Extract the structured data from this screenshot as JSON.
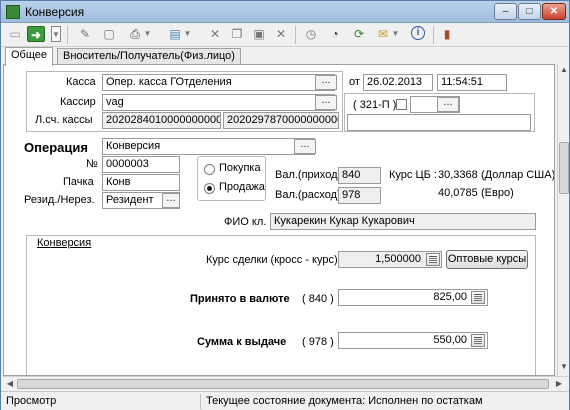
{
  "window": {
    "title": "Конверсия"
  },
  "tabs": [
    {
      "label": "Общее"
    },
    {
      "label": "Вноситель/Получатель(Физ.лицо)"
    }
  ],
  "cash": {
    "kassa_label": "Касса",
    "kassa_value": "Опер. касса ГОтделения",
    "cashier_label": "Кассир",
    "cashier_value": "vag",
    "account_label": "Л.сч. кассы",
    "account_1": "20202840100000000001",
    "account_2": "20202978700000000001",
    "date_label": "от",
    "date_value": "26.02.2013",
    "time_value": "11:54:51",
    "form_code": "( 321-П )"
  },
  "operation": {
    "title": "Операция",
    "value": "Конверсия",
    "number_label": "№",
    "number_value": "0000003",
    "pack_label": "Пачка",
    "pack_value": "Конв",
    "resident_label": "Резид./Нерез.",
    "resident_value": "Резидент",
    "buy_label": "Покупка",
    "sell_label": "Продажа",
    "cur_in_label": "Вал.(приход)",
    "cur_in_code": "840",
    "cur_out_label": "Вал.(расход)",
    "cur_out_code": "978",
    "cb_rate_label": "Курс ЦБ :",
    "cb_rate_1": "30,3368",
    "cb_rate_1_cur": "(Доллар США)",
    "cb_rate_2": "40,0785",
    "cb_rate_2_cur": "(Евро)",
    "fio_label": "ФИО кл.",
    "fio_value": "Кукарекин Кукар Кукарович"
  },
  "conversion": {
    "section_title": "Конверсия",
    "deal_rate_label": "Курс сделки (кросс - курс)",
    "deal_rate_value": "1,500000",
    "wholesale_button": "Оптовые курсы",
    "received_label": "Принято в валюте",
    "received_code": "( 840 )",
    "received_amount": "825,00",
    "payout_label": "Сумма к выдаче",
    "payout_code": "( 978 )",
    "payout_amount": "550,00"
  },
  "status": {
    "mode": "Просмотр",
    "state": "Текущее состояние документа: Исполнен по остаткам"
  },
  "ellipsis": "..."
}
